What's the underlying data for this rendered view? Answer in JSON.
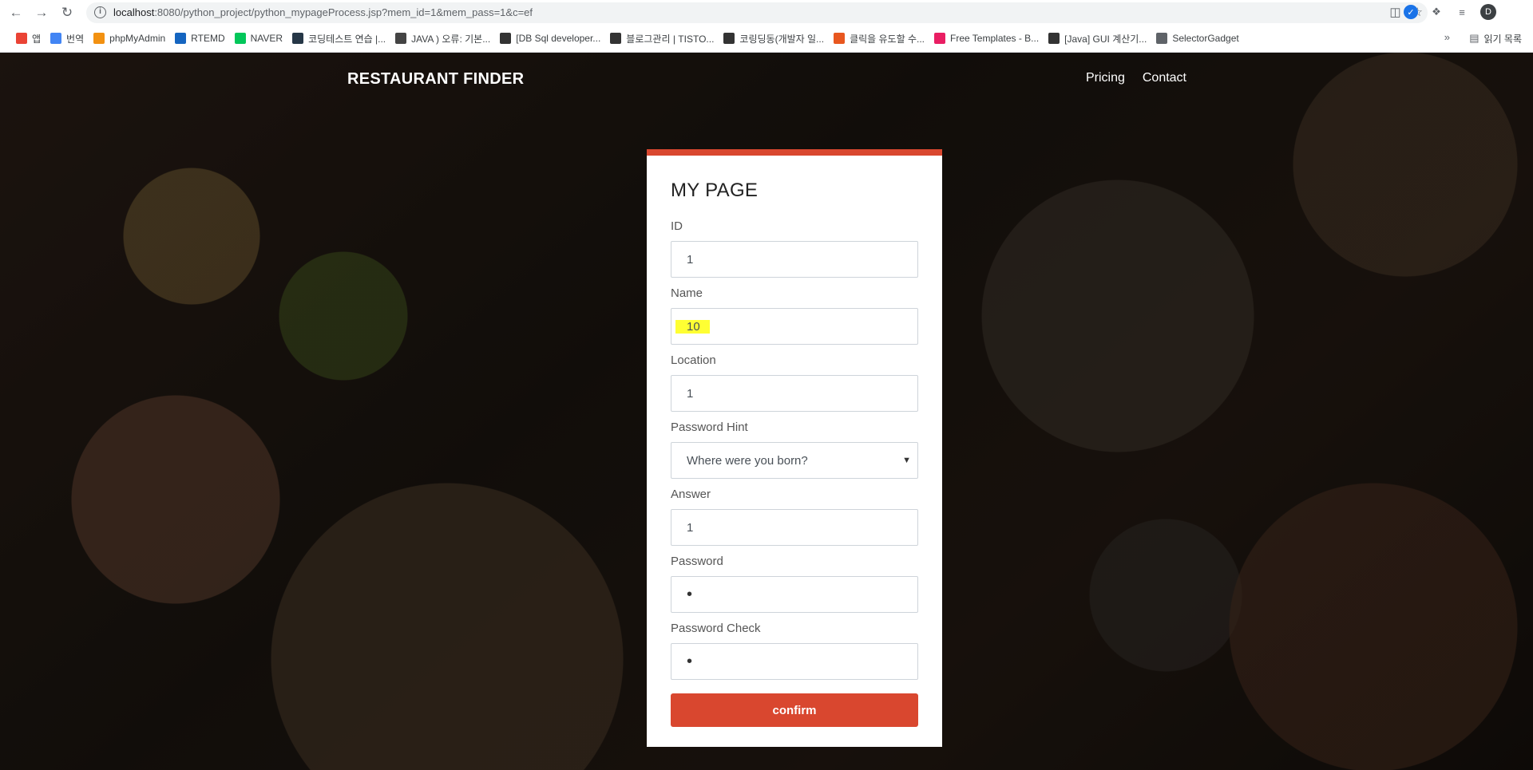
{
  "browser": {
    "url_host": "localhost",
    "url_rest": ":8080/python_project/python_mypageProcess.jsp?mem_id=1&mem_pass=1&c=ef",
    "avatar_letter": "D",
    "bookmarks": [
      {
        "label": "앱",
        "icon": "apps-grid-icon",
        "color": "#ea4335"
      },
      {
        "label": "번역",
        "icon": "translate-icon",
        "color": "#4285f4"
      },
      {
        "label": "phpMyAdmin",
        "icon": "phpmyadmin-icon",
        "color": "#f29111"
      },
      {
        "label": "RTEMD",
        "icon": "rtemd-icon",
        "color": "#1565c0"
      },
      {
        "label": "NAVER",
        "icon": "naver-icon",
        "color": "#03c75a"
      },
      {
        "label": "코딩테스트 연습 |...",
        "icon": "programmers-icon",
        "color": "#263747"
      },
      {
        "label": "JAVA ) 오류: 기본...",
        "icon": "java-icon",
        "color": "#444444"
      },
      {
        "label": "[DB Sql developer...",
        "icon": "tistory-icon",
        "color": "#333333"
      },
      {
        "label": "블로그관리 | TISTO...",
        "icon": "tistory-icon",
        "color": "#333333"
      },
      {
        "label": "코링딩동(개발자 일...",
        "icon": "tistory-icon",
        "color": "#333333"
      },
      {
        "label": "클릭을 유도할 수...",
        "icon": "bookmark-orange-icon",
        "color": "#e8571f"
      },
      {
        "label": "Free Templates - B...",
        "icon": "templates-icon",
        "color": "#e91e63"
      },
      {
        "label": "[Java] GUI 계산기...",
        "icon": "tistory-icon",
        "color": "#333333"
      },
      {
        "label": "SelectorGadget",
        "icon": "selectorgadget-icon",
        "color": "#5f6368"
      }
    ],
    "reading_list": "읽기 목록"
  },
  "site": {
    "brand": "RESTAURANT FINDER",
    "nav": [
      "Pricing",
      "Contact"
    ]
  },
  "form": {
    "title": "MY PAGE",
    "id_label": "ID",
    "id_value": "1",
    "name_label": "Name",
    "name_value": "10",
    "location_label": "Location",
    "location_value": "1",
    "hint_label": "Password Hint",
    "hint_value": "Where were you born?",
    "answer_label": "Answer",
    "answer_value": "1",
    "password_label": "Password",
    "password_value": "•",
    "password_check_label": "Password Check",
    "password_check_value": "•",
    "confirm_label": "confirm"
  },
  "colors": {
    "accent": "#d9472f",
    "highlight": "#ffff33"
  }
}
